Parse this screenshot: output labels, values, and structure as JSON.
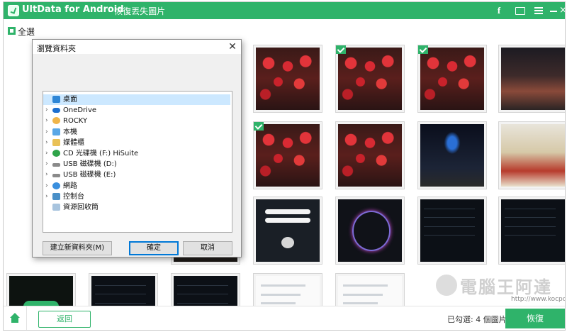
{
  "header": {
    "app_name": "UltData for Android",
    "subtitle": "- 恢復丟失圖片",
    "icons": [
      "facebook-icon",
      "feedback-icon",
      "menu-icon",
      "minimize-icon",
      "close-icon"
    ],
    "facebook_glyph": "f",
    "close_glyph": "×",
    "bg_color": "#2fb36a"
  },
  "toolbar": {
    "select_all_label": "全選"
  },
  "dialog": {
    "title": "瀏覽資料夾",
    "close_glyph": "✕",
    "tree": [
      {
        "label": "桌面",
        "icon": "desktop-icon",
        "expandable": false,
        "selected": true
      },
      {
        "label": "OneDrive",
        "icon": "cloud-icon",
        "expandable": true
      },
      {
        "label": "ROCKY",
        "icon": "user-icon",
        "expandable": true
      },
      {
        "label": "本機",
        "icon": "computer-icon",
        "expandable": true
      },
      {
        "label": "媒體櫃",
        "icon": "library-icon",
        "expandable": true
      },
      {
        "label": "CD 光碟機 (F:) HiSuite",
        "icon": "cd-drive-icon",
        "expandable": true
      },
      {
        "label": "USB 磁碟機 (D:)",
        "icon": "usb-drive-icon",
        "expandable": true
      },
      {
        "label": "USB 磁碟機 (E:)",
        "icon": "usb-drive-icon",
        "expandable": true
      },
      {
        "label": "網路",
        "icon": "network-icon",
        "expandable": true
      },
      {
        "label": "控制台",
        "icon": "control-panel-icon",
        "expandable": true
      },
      {
        "label": "資源回收筒",
        "icon": "recycle-bin-icon",
        "expandable": false
      }
    ],
    "caret_glyph": "›",
    "buttons": {
      "new_folder": "建立新資料夾(M)",
      "ok": "確定",
      "cancel": "取消"
    }
  },
  "gallery": {
    "tiles": [
      {
        "kind": "food",
        "checked": false
      },
      {
        "kind": "lanterns",
        "checked": false
      },
      {
        "kind": "lanterns",
        "checked": true
      },
      {
        "kind": "lanterns",
        "checked": true
      },
      {
        "kind": "street",
        "checked": false
      },
      {
        "kind": "lanterns",
        "checked": true
      },
      {
        "kind": "lanterns",
        "checked": true
      },
      {
        "kind": "lanterns",
        "checked": false
      },
      {
        "kind": "tower",
        "checked": false
      },
      {
        "kind": "mall",
        "checked": false
      },
      {
        "kind": "night",
        "checked": false
      },
      {
        "kind": "dark-ui",
        "checked": false
      },
      {
        "kind": "ring-ui",
        "checked": false
      },
      {
        "kind": "app-list",
        "checked": false
      },
      {
        "kind": "app-list",
        "checked": false
      },
      {
        "kind": "green-pill",
        "checked": false
      },
      {
        "kind": "app-list",
        "checked": false
      },
      {
        "kind": "app-list",
        "checked": false
      },
      {
        "kind": "white-doc",
        "checked": false
      },
      {
        "kind": "white-doc",
        "checked": false
      }
    ]
  },
  "footer": {
    "back_label": "返回",
    "selected_text": "已勾選: 4 個圖片",
    "recover_label": "恢復"
  },
  "watermark": {
    "text": "電腦王阿達",
    "url": "http://www.kocpc.com.tw"
  }
}
